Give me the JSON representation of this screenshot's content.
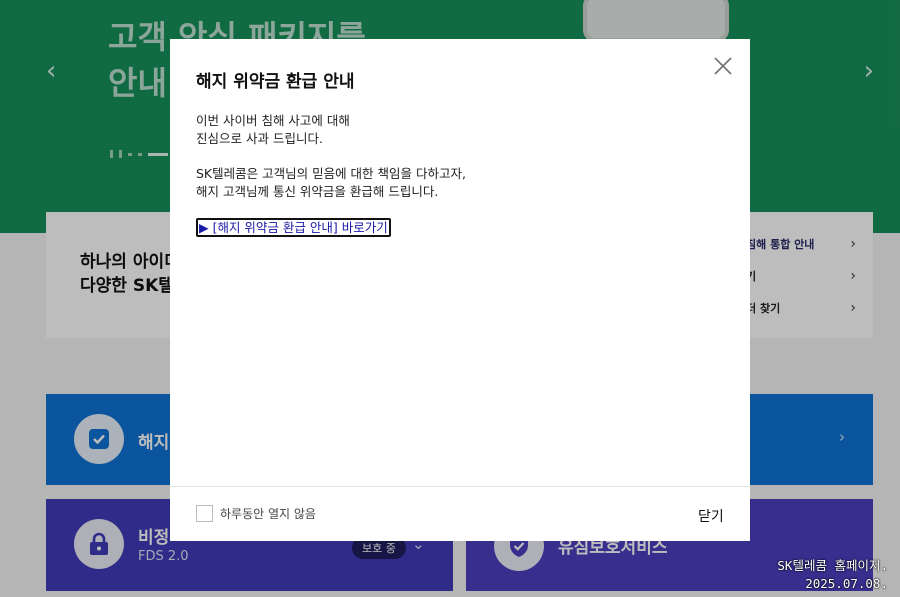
{
  "hero": {
    "title": "고객 안심 패키지를\n안내",
    "prev_glyph": "‹",
    "next_glyph": "›"
  },
  "intro": {
    "text": "하나의 아이디\n다양한 SK텔",
    "links": [
      {
        "label": "침해 통합 안내"
      },
      {
        "label": "기"
      },
      {
        "label": "더 찾기"
      }
    ]
  },
  "services": {
    "blue": {
      "title": "해지",
      "icon": "check-icon"
    },
    "purple_left": {
      "title": "비정",
      "subtitle": "FDS 2.0",
      "badge": "보호 중",
      "icon": "lock-icon"
    },
    "purple_right": {
      "title": "유심보호서비스",
      "icon": "shield-check-icon"
    }
  },
  "modal": {
    "title": "해지 위약금 환급 안내",
    "paragraph1": [
      "이번 사이버 침해 사고에 대해",
      "진심으로 사과 드립니다."
    ],
    "paragraph2": [
      "SK텔레콤은 고객님의 믿음에 대한 책임을 다하고자,",
      "해지 고객님께 통신 위약금을 환급해 드립니다."
    ],
    "link_label": "▶ [해지 위약금 환급 안내] 바로가기",
    "dismiss_label": "하루동안 열지 않음",
    "close_label": "닫기"
  },
  "watermark": {
    "line1": "SK텔레콤 홈페이지.",
    "line2": "2025.07.08."
  },
  "colors": {
    "hero_green": "#18915a",
    "service_blue": "#0f72d5",
    "service_purple": "#3f3cb8",
    "link_blue": "#1a1aa6"
  }
}
